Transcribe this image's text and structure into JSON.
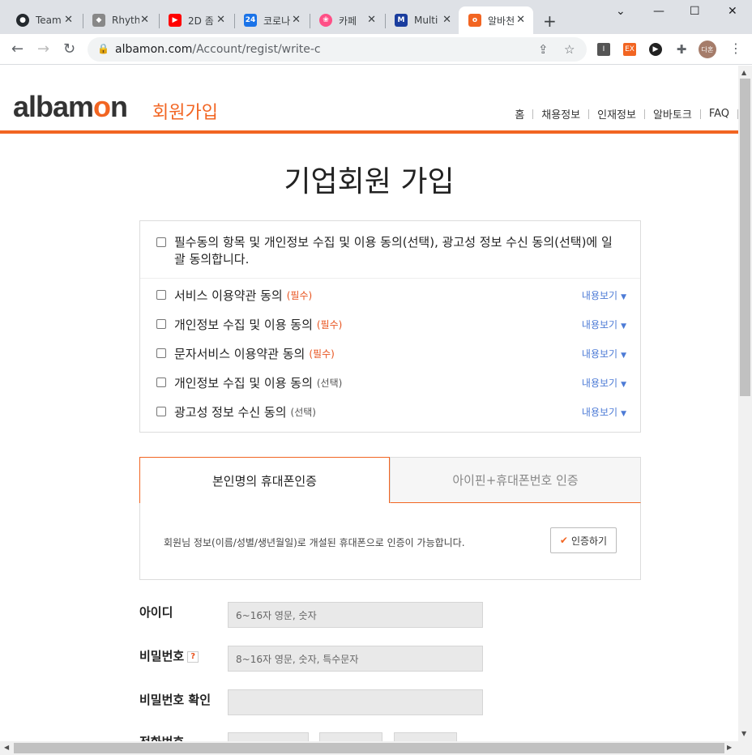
{
  "browser": {
    "tabs": [
      {
        "title": "Team",
        "icon": "github-icon",
        "color": "#24292e"
      },
      {
        "title": "Rhyth",
        "icon": "unity-icon",
        "color": "#888888"
      },
      {
        "title": "2D 좀",
        "icon": "youtube-icon",
        "color": "#ff0000"
      },
      {
        "title": "코로나",
        "icon": "24-icon",
        "color": "#1a73e8"
      },
      {
        "title": "카페",
        "icon": "cafe-icon",
        "color": "#ff4f86"
      },
      {
        "title": "Multi",
        "icon": "multi-icon",
        "color": "#1a3d9e"
      },
      {
        "title": "알바천",
        "icon": "albamon-icon",
        "color": "#f26522"
      }
    ],
    "url_domain": "albamon.com",
    "url_path": "/Account/regist/write-c",
    "profile": "다혼"
  },
  "header": {
    "logo_main": "albam",
    "logo_accent": "o",
    "logo_tail": "n",
    "logo_sub": "회원가입",
    "nav": [
      "홈",
      "채용정보",
      "인재정보",
      "알바토크",
      "FAQ"
    ]
  },
  "page_title": "기업회원 가입",
  "agreements": {
    "all": "필수동의 항목 및 개인정보 수집 및 이용 동의(선택), 광고성 정보 수신 동의(선택)에 일괄 동의합니다.",
    "view_label": "내용보기",
    "items": [
      {
        "label": "서비스 이용약관 동의",
        "tag": "(필수)",
        "required": true
      },
      {
        "label": "개인정보 수집 및 이용 동의",
        "tag": "(필수)",
        "required": true
      },
      {
        "label": "문자서비스 이용약관 동의",
        "tag": "(필수)",
        "required": true
      },
      {
        "label": "개인정보 수집 및 이용 동의",
        "tag": "(선택)",
        "required": false
      },
      {
        "label": "광고성 정보 수신 동의",
        "tag": "(선택)",
        "required": false
      }
    ]
  },
  "auth": {
    "tab_active": "본인명의 휴대폰인증",
    "tab_inactive": "아이핀+휴대폰번호 인증",
    "description": "회원님 정보(이름/성별/생년월일)로 개설된 휴대폰으로 인증이 가능합니다.",
    "button": "인증하기"
  },
  "form": {
    "id_label": "아이디",
    "id_placeholder": "6~16자 영문, 숫자",
    "pw_label": "비밀번호",
    "pw_help": "?",
    "pw_placeholder": "8~16자 영문, 숫자, 특수문자",
    "pw_confirm_label": "비밀번호 확인",
    "phone_label": "전화번호"
  },
  "colors": {
    "brand": "#f26522",
    "link": "#4d7bd6"
  }
}
